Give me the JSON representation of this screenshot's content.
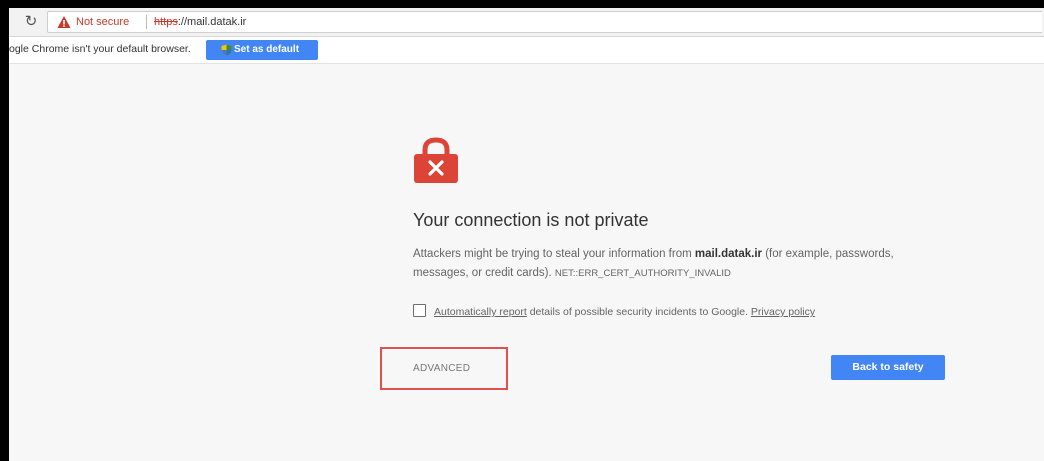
{
  "omnibox": {
    "security_label": "Not secure",
    "scheme": "https",
    "url_rest": "://mail.datak.ir"
  },
  "infobar": {
    "message": "ogle Chrome isn't your default browser.",
    "button_label": "Set as default"
  },
  "interstitial": {
    "heading": "Your connection is not private",
    "explanation_before": "Attackers might be trying to steal your information from ",
    "domain": "mail.datak.ir",
    "explanation_after": " (for example, passwords, messages, or credit cards). ",
    "error_code": "NET::ERR_CERT_AUTHORITY_INVALID",
    "report_link": "Automatically report",
    "report_text": " details of possible security incidents to Google. ",
    "privacy_link": "Privacy policy",
    "advanced_label": "ADVANCED",
    "back_label": "Back to safety"
  },
  "colors": {
    "danger_red": "#db4437",
    "primary_blue": "#4285f4",
    "highlight_box": "#e05050"
  },
  "icons": {
    "reload": "reload-icon",
    "warning": "warning-triangle-icon",
    "shield": "shield-icon",
    "lock": "broken-lock-icon"
  }
}
